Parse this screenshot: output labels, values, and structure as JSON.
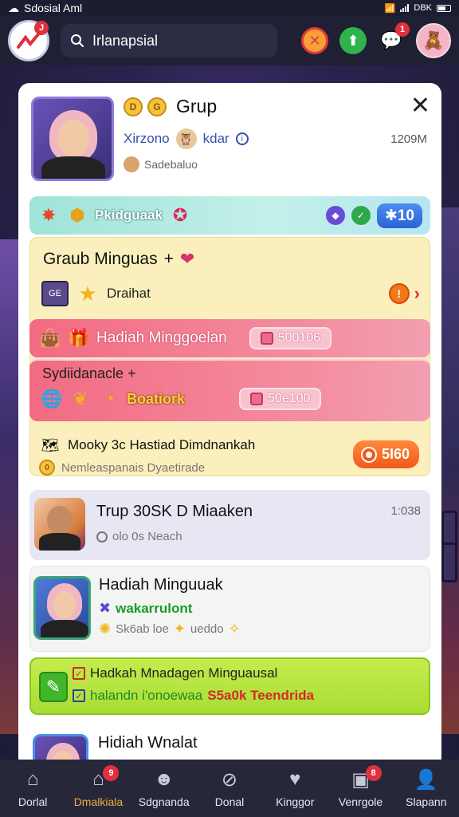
{
  "status_bar": {
    "title": "Sdosial Aml",
    "battery": "DBK"
  },
  "search": {
    "value": "Irlanapsial"
  },
  "top_icons": {
    "chat_badge": "1"
  },
  "logo_badge": "J",
  "card": {
    "title": "Grup",
    "subtitle_a": "Xirzono",
    "subtitle_b": "kdar",
    "time": "1209M",
    "meta": "Sadebaluo"
  },
  "teal": {
    "label": "Pkidguaak",
    "pill": "✱10"
  },
  "yellow": {
    "title": "Graub Minguas",
    "title_suffix": "+",
    "row_label": "Draihat",
    "chip_label": "GE"
  },
  "pink1": {
    "label": "Hadiah Minggoelan",
    "pill": "500106"
  },
  "pink2": {
    "title": "Sydiidanacle",
    "title_suffix": "+",
    "boat": "Boatiork",
    "pill": "50e100"
  },
  "ybottom": {
    "title": "Mooky 3c Hastiad Dimdnankah",
    "sub": "Nemleaspanais Dyaetirade",
    "pill": "5I60"
  },
  "list": [
    {
      "title": "Trup 30SK D Miaaken",
      "time": "1:038",
      "sub": "olo 0s Neach"
    },
    {
      "title": "Hadiah Minguuak",
      "accent": "wakarrulont",
      "sub_a": "Sk6ab loe",
      "sub_b": "ueddo"
    },
    {
      "line1": "Hadkah Mnadagen Minguausal",
      "line2_a": "halandn i'onoewaa",
      "line2_b": "S5a0k Teendrida"
    },
    {
      "title": "Hidiah Wnalat"
    }
  ],
  "nav": [
    {
      "label": "Dorlal",
      "icon": "home-icon",
      "badge": ""
    },
    {
      "label": "Dmalkiala",
      "icon": "store-icon",
      "badge": "9"
    },
    {
      "label": "Sdgnanda",
      "icon": "people-icon",
      "badge": ""
    },
    {
      "label": "Donal",
      "icon": "search-icon",
      "badge": ""
    },
    {
      "label": "Kinggor",
      "icon": "heart-icon",
      "badge": ""
    },
    {
      "label": "Venrgole",
      "icon": "gallery-icon",
      "badge": "8"
    },
    {
      "label": "Slapann",
      "icon": "profile-icon",
      "badge": ""
    }
  ],
  "colors": {
    "accent": "#f4a93a",
    "nav_bg": "#26283a",
    "badge": "#e0303c"
  }
}
